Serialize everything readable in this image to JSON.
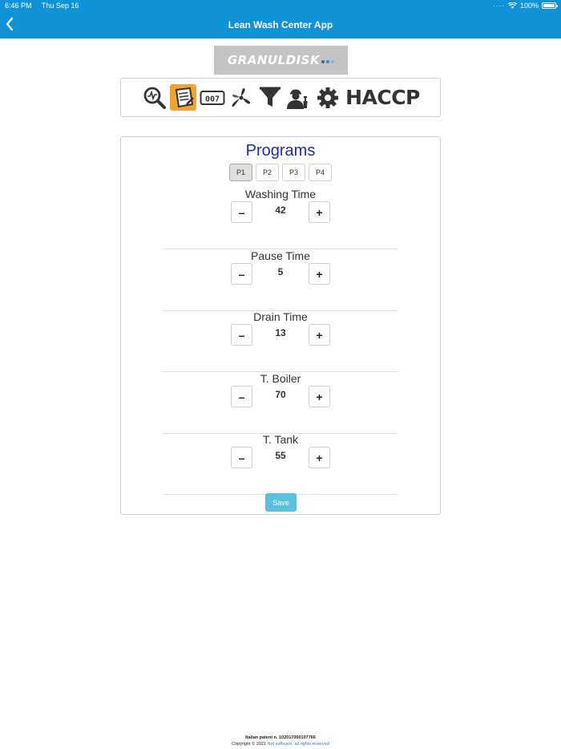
{
  "status_bar": {
    "time": "6:46 PM",
    "date": "Thu Sep 16",
    "battery": "100%"
  },
  "header": {
    "title": "Lean Wash Center App"
  },
  "logo": {
    "text": "GRANULDISK"
  },
  "toolbar": {
    "icons": [
      "search-graph-icon",
      "checklist-icon",
      "counter-icon",
      "fan-icon",
      "filter-icon",
      "technician-icon",
      "gear-icon"
    ],
    "active": "checklist-icon",
    "haccp_label": "HACCP",
    "accent_color": "#f2a431"
  },
  "programs": {
    "title": "Programs",
    "tabs": [
      "P1",
      "P2",
      "P3",
      "P4"
    ],
    "selected_tab": "P1",
    "fields": [
      {
        "label": "Washing Time",
        "value": "42"
      },
      {
        "label": "Pause Time",
        "value": "5"
      },
      {
        "label": "Drain Time",
        "value": "13"
      },
      {
        "label": "T. Boiler",
        "value": "70"
      },
      {
        "label": "T. Tank",
        "value": "55"
      }
    ],
    "minus_label": "–",
    "plus_label": "+",
    "save_label": "Save"
  },
  "footer": {
    "patent": "Italian patent n. 102017000107766",
    "copyright": "Copyright © 2021",
    "link_text": "Net software, all rights reserved"
  },
  "colors": {
    "header_bg": "#0f93d6",
    "title_blue": "#1f2ea0",
    "save_bg": "#5bc0de"
  }
}
